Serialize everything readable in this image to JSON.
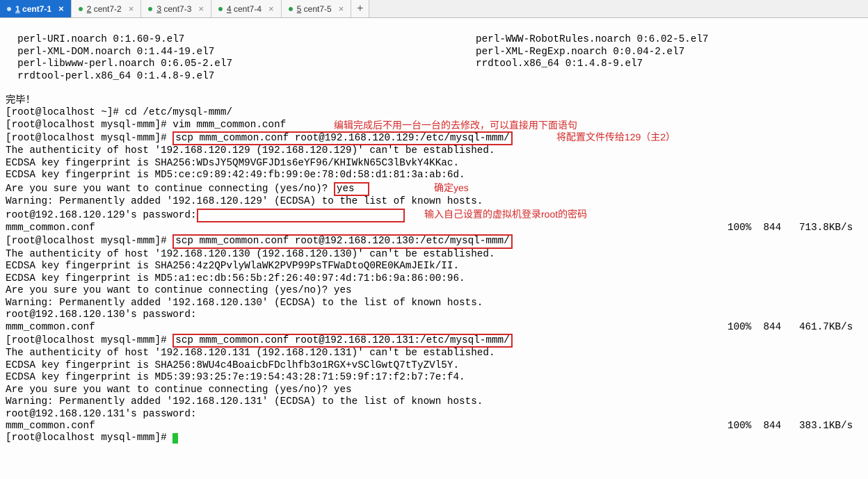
{
  "tabs": {
    "items": [
      {
        "num": "1",
        "label": "cent7-1",
        "active": true,
        "dirty": true
      },
      {
        "num": "2",
        "label": "cent7-2",
        "active": false,
        "dirty": true
      },
      {
        "num": "3",
        "label": "cent7-3",
        "active": false,
        "dirty": true
      },
      {
        "num": "4",
        "label": "cent7-4",
        "active": false,
        "dirty": true
      },
      {
        "num": "5",
        "label": "cent7-5",
        "active": false,
        "dirty": true
      }
    ],
    "add": "+",
    "close": "×"
  },
  "term": {
    "pkg_left": [
      "  perl-URI.noarch 0:1.60-9.el7",
      "  perl-XML-DOM.noarch 0:1.44-19.el7",
      "  perl-libwww-perl.noarch 0:6.05-2.el7",
      "  rrdtool-perl.x86_64 0:1.4.8-9.el7"
    ],
    "pkg_right": [
      "perl-WWW-RobotRules.noarch 0:6.02-5.el7",
      "perl-XML-RegExp.noarch 0:0.04-2.el7",
      "rrdtool.x86_64 0:1.4.8-9.el7",
      ""
    ],
    "done": "完毕！",
    "prompt_root": "[root@localhost ~]# ",
    "prompt_mmm": "[root@localhost mysql-mmm]# ",
    "cmd_cd": "cd /etc/mysql-mmm/",
    "cmd_vim": "vim mmm_common.conf",
    "scp1": "scp mmm_common.conf root@192.168.120.129:/etc/mysql-mmm/",
    "scp2": "scp mmm_common.conf root@192.168.120.130:/etc/mysql-mmm/",
    "scp3": "scp mmm_common.conf root@192.168.120.131:/etc/mysql-mmm/",
    "auth129": "The authenticity of host '192.168.120.129 (192.168.120.129)' can't be established.",
    "fp129a": "ECDSA key fingerprint is SHA256:WDsJY5QM9VGFJD1s6eYF96/KHIWkN65C3lBvkY4KKac.",
    "fp129b": "ECDSA key fingerprint is MD5:ce:c9:89:42:49:fb:99:0e:78:0d:58:d1:81:3a:ab:6d.",
    "sure_pre": "Are you sure you want to continue connecting (yes/no)? ",
    "yes": "yes",
    "warn129": "Warning: Permanently added '192.168.120.129' (ECDSA) to the list of known hosts.",
    "pw129": "root@192.168.120.129's password:",
    "file": "mmm_common.conf",
    "xfer1": "100%  844   713.8KB/s",
    "auth130": "The authenticity of host '192.168.120.130 (192.168.120.130)' can't be established.",
    "fp130a": "ECDSA key fingerprint is SHA256:4z2QPvlyWlaWK2PVP99PsTFWaDtoQ0RE0KAmJEIk/II.",
    "fp130b": "ECDSA key fingerprint is MD5:a1:ec:db:56:5b:2f:26:40:97:4d:71:b6:9a:86:00:96.",
    "sure_yes_plain": "Are you sure you want to continue connecting (yes/no)? yes",
    "warn130": "Warning: Permanently added '192.168.120.130' (ECDSA) to the list of known hosts.",
    "pw130": "root@192.168.120.130's password:",
    "xfer2": "100%  844   461.7KB/s",
    "auth131": "The authenticity of host '192.168.120.131 (192.168.120.131)' can't be established.",
    "fp131a": "ECDSA key fingerprint is SHA256:8WU4c4BoaicbFDclhfb3o1RGX+vSClGwtQ7tTyZVl5Y.",
    "fp131b": "ECDSA key fingerprint is MD5:39:93:25:7e:19:54:43:28:71:59:9f:17:f2:b7:7e:f4.",
    "warn131": "Warning: Permanently added '192.168.120.131' (ECDSA) to the list of known hosts.",
    "pw131": "root@192.168.120.131's password:",
    "xfer3": "100%  844   383.1KB/s"
  },
  "anno": {
    "a1": "编辑完成后不用一台一台的去修改，可以直接用下面语句",
    "a2": "将配置文件传给129（主2）",
    "a3": "确定yes",
    "a4": "输入自己设置的虚拟机登录root的密码"
  }
}
